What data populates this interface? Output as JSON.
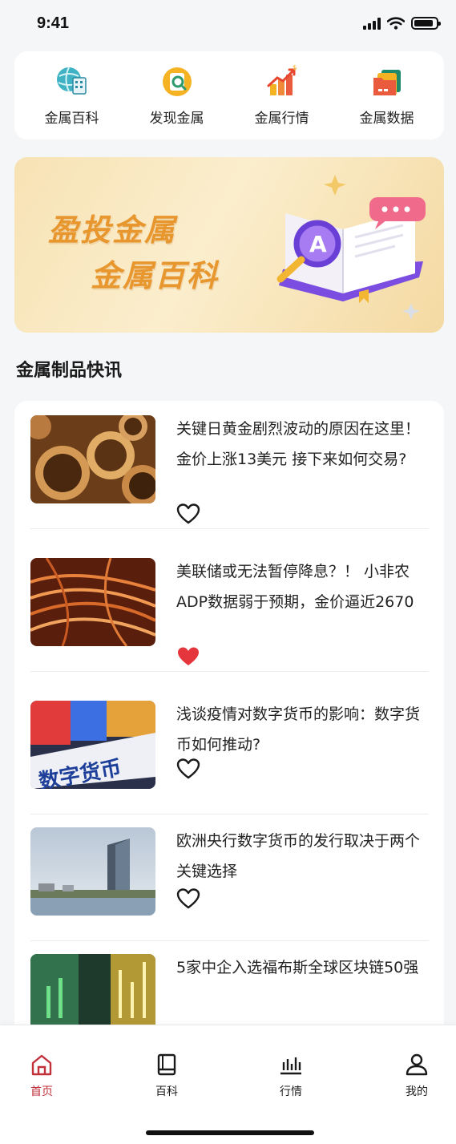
{
  "status_bar": {
    "time": "9:41",
    "battery_level": 0.9
  },
  "quick_nav": [
    {
      "label": "金属百科",
      "icon": "globe-building-icon"
    },
    {
      "label": "发现金属",
      "icon": "magnifier-coin-icon"
    },
    {
      "label": "金属行情",
      "icon": "chart-up-icon"
    },
    {
      "label": "金属数据",
      "icon": "folders-icon"
    }
  ],
  "banner": {
    "line1": "盈投金属",
    "line2": "金属百科"
  },
  "section": {
    "title": "金属制品快讯"
  },
  "news": [
    {
      "title": "关键日黄金剧烈波动的原因在这里！金价上涨13美元 接下来如何交易?",
      "liked": false,
      "thumb": "copper-pipes"
    },
    {
      "title": "美联储或无法暂停降息？！ 小非农ADP数据弱于预期，金价逼近2670",
      "liked": true,
      "thumb": "copper-wire"
    },
    {
      "title": "浅谈疫情对数字货币的影响：数字货币如何推动?",
      "liked": false,
      "thumb": "digital-currency"
    },
    {
      "title": "欧洲央行数字货币的发行取决于两个关键选择",
      "liked": false,
      "thumb": "city-skyline"
    },
    {
      "title": "5家中企入选福布斯全球区块链50强",
      "liked": false,
      "thumb": "finance-chart"
    }
  ],
  "tabs": [
    {
      "label": "首页",
      "icon": "home-icon",
      "active": true
    },
    {
      "label": "百科",
      "icon": "book-icon",
      "active": false
    },
    {
      "label": "行情",
      "icon": "bar-chart-icon",
      "active": false
    },
    {
      "label": "我的",
      "icon": "user-icon",
      "active": false
    }
  ],
  "colors": {
    "accent": "#c2303a",
    "like_red": "#e5363d",
    "banner_text": "#e8962e"
  }
}
